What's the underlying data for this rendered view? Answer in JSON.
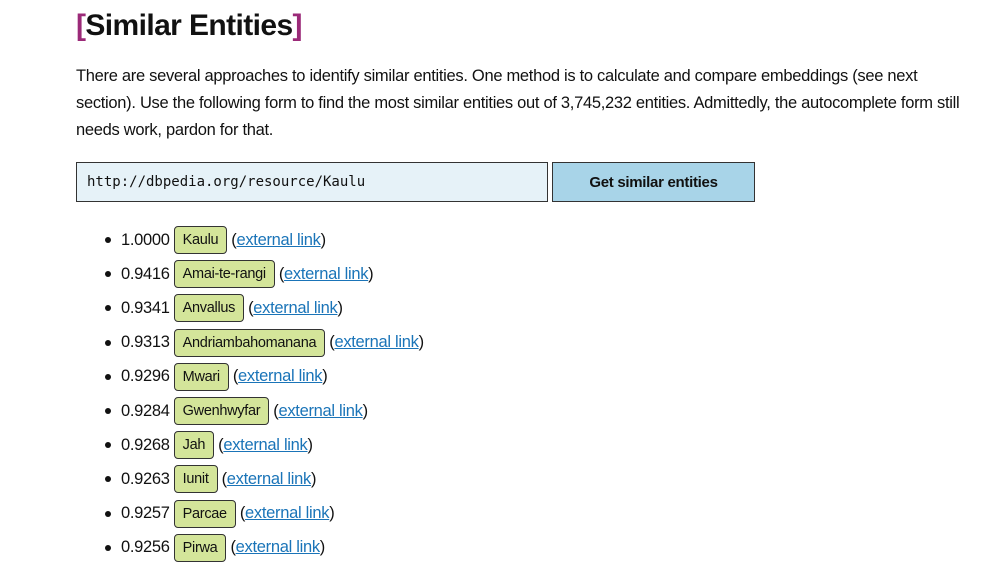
{
  "section": {
    "title": "Similar Entities",
    "bracket_open": "[",
    "bracket_close": "]",
    "intro": "There are several approaches to identify similar entities. One method is to calculate and compare embeddings (see next section). Use the following form to find the most similar entities out of 3,745,232 entities. Admittedly, the autocomplete form still needs work, pardon for that."
  },
  "form": {
    "input_value": "http://dbpedia.org/resource/Kaulu",
    "submit_label": "Get similar entities"
  },
  "results": [
    {
      "score": "1.0000",
      "entity": "Kaulu",
      "link_label": "external link"
    },
    {
      "score": "0.9416",
      "entity": "Amai-te-rangi",
      "link_label": "external link"
    },
    {
      "score": "0.9341",
      "entity": "Anvallus",
      "link_label": "external link"
    },
    {
      "score": "0.9313",
      "entity": "Andriambahomanana",
      "link_label": "external link"
    },
    {
      "score": "0.9296",
      "entity": "Mwari",
      "link_label": "external link"
    },
    {
      "score": "0.9284",
      "entity": "Gwenhwyfar",
      "link_label": "external link"
    },
    {
      "score": "0.9268",
      "entity": "Jah",
      "link_label": "external link"
    },
    {
      "score": "0.9263",
      "entity": "Iunit",
      "link_label": "external link"
    },
    {
      "score": "0.9257",
      "entity": "Parcae",
      "link_label": "external link"
    },
    {
      "score": "0.9256",
      "entity": "Pirwa",
      "link_label": "external link"
    }
  ],
  "colors": {
    "bracket": "#9b2a78",
    "input_bg": "#e6f2f8",
    "button_bg": "#a8d4e8",
    "tag_bg": "#d4e59a",
    "link": "#1a74b8"
  }
}
